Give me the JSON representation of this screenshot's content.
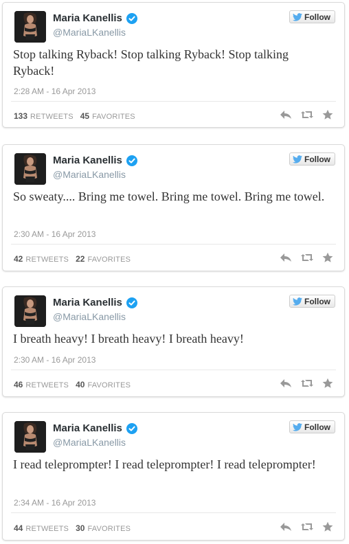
{
  "tweets": [
    {
      "author_name": "Maria Kanellis",
      "handle": "@MariaLKanellis",
      "follow_label": "Follow",
      "text": "Stop talking Ryback! Stop talking Ryback! Stop talking Ryback!",
      "timestamp": "2:28 AM - 16 Apr 2013",
      "retweets": "133",
      "retweets_label": "RETWEETS",
      "favorites": "45",
      "favorites_label": "FAVORITES"
    },
    {
      "author_name": "Maria Kanellis",
      "handle": "@MariaLKanellis",
      "follow_label": "Follow",
      "text": "So sweaty.... Bring me towel. Bring me towel. Bring me towel.",
      "timestamp": "2:30 AM - 16 Apr 2013",
      "retweets": "42",
      "retweets_label": "RETWEETS",
      "favorites": "22",
      "favorites_label": "FAVORITES"
    },
    {
      "author_name": "Maria Kanellis",
      "handle": "@MariaLKanellis",
      "follow_label": "Follow",
      "text": "I breath heavy! I breath heavy! I breath heavy!",
      "timestamp": "2:30 AM - 16 Apr 2013",
      "retweets": "46",
      "retweets_label": "RETWEETS",
      "favorites": "40",
      "favorites_label": "FAVORITES"
    },
    {
      "author_name": "Maria Kanellis",
      "handle": "@MariaLKanellis",
      "follow_label": "Follow",
      "text": "I read teleprompter! I read teleprompter! I read teleprompter!",
      "timestamp": "2:34 AM - 16 Apr 2013",
      "retweets": "44",
      "retweets_label": "RETWEETS",
      "favorites": "30",
      "favorites_label": "FAVORITES"
    }
  ],
  "colors": {
    "verified": "#1da1f2",
    "twitter_blue": "#55acee",
    "action_icon": "#999999",
    "card_border": "#d9d9d9"
  },
  "icons": {
    "verified": "verified-badge-icon",
    "bird": "twitter-bird-icon",
    "reply": "reply-icon",
    "retweet": "retweet-icon",
    "favorite": "star-icon"
  }
}
